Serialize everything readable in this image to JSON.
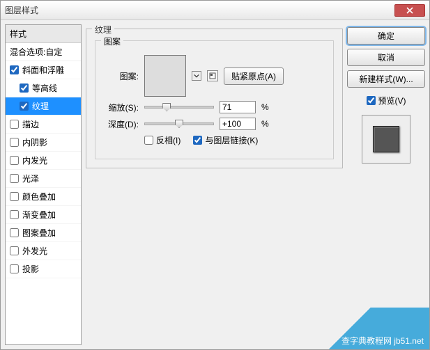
{
  "window": {
    "title": "图层样式"
  },
  "styles_panel": {
    "header": "样式",
    "blend_row": "混合选项:自定",
    "items": [
      {
        "label": "斜面和浮雕",
        "checked": true,
        "indent": false,
        "selected": false
      },
      {
        "label": "等高线",
        "checked": true,
        "indent": true,
        "selected": false
      },
      {
        "label": "纹理",
        "checked": true,
        "indent": true,
        "selected": true
      },
      {
        "label": "描边",
        "checked": false,
        "indent": false,
        "selected": false
      },
      {
        "label": "内阴影",
        "checked": false,
        "indent": false,
        "selected": false
      },
      {
        "label": "内发光",
        "checked": false,
        "indent": false,
        "selected": false
      },
      {
        "label": "光泽",
        "checked": false,
        "indent": false,
        "selected": false
      },
      {
        "label": "颜色叠加",
        "checked": false,
        "indent": false,
        "selected": false
      },
      {
        "label": "渐变叠加",
        "checked": false,
        "indent": false,
        "selected": false
      },
      {
        "label": "图案叠加",
        "checked": false,
        "indent": false,
        "selected": false
      },
      {
        "label": "外发光",
        "checked": false,
        "indent": false,
        "selected": false
      },
      {
        "label": "投影",
        "checked": false,
        "indent": false,
        "selected": false
      }
    ]
  },
  "texture": {
    "group_title": "纹理",
    "pattern_group": "图案",
    "pattern_label": "图案:",
    "snap_origin": "贴紧原点(A)",
    "scale_label": "缩放(S):",
    "scale_value": "71",
    "scale_pct": 71,
    "depth_label": "深度(D):",
    "depth_value": "+100",
    "depth_pct": 50,
    "percent": "%",
    "invert_label": "反相(I)",
    "invert_checked": false,
    "link_label": "与图层链接(K)",
    "link_checked": true
  },
  "buttons": {
    "ok": "确定",
    "cancel": "取消",
    "new_style": "新建样式(W)...",
    "preview": "预览(V)"
  },
  "watermark": "查字典教程网 jb51.net"
}
